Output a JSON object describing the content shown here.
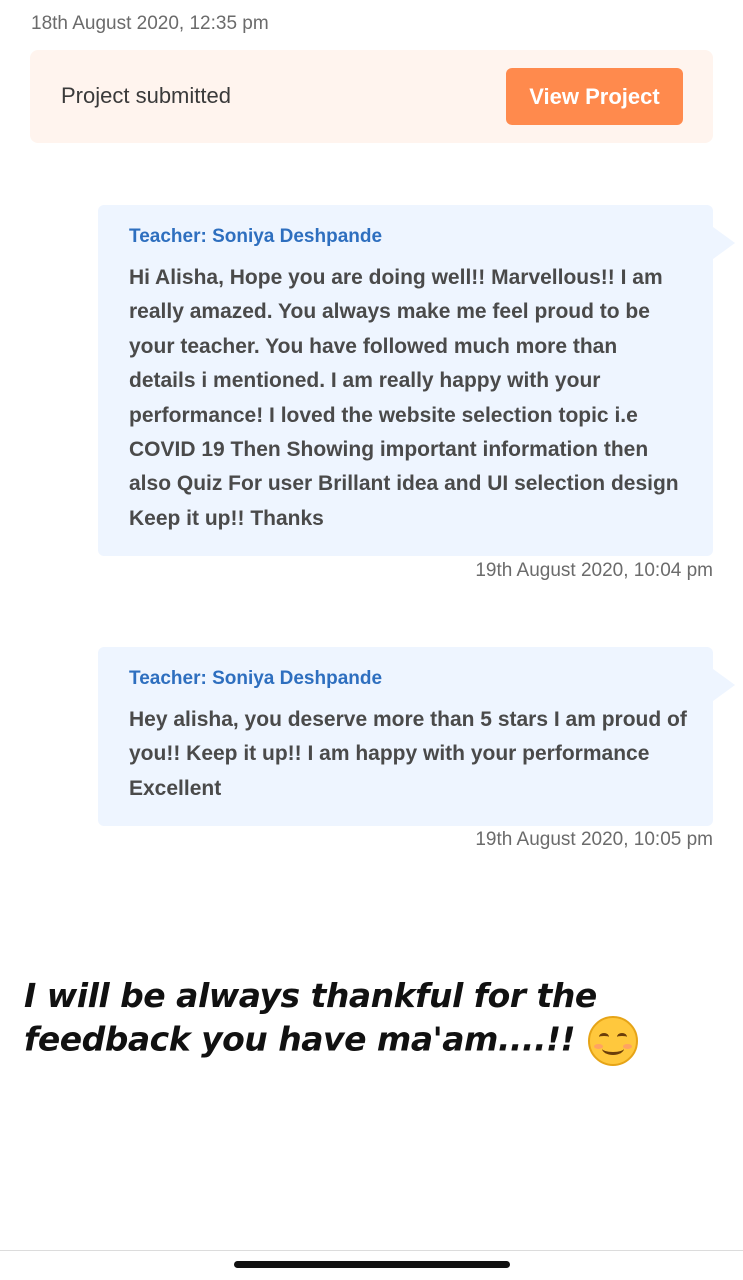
{
  "header": {
    "timestamp": "18th August 2020, 12:35 pm"
  },
  "submission": {
    "label": "Project submitted",
    "button_label": "View Project"
  },
  "messages": [
    {
      "sender": "Teacher: Soniya Deshpande",
      "text": "Hi Alisha, Hope you are doing well!! Marvellous!! I am really amazed. You always make me feel proud to be your teacher. You have followed much more than details i mentioned. I am really happy with your performance! I loved the website selection topic i.e COVID 19 Then Showing important information then also Quiz For user Brillant idea and UI selection design Keep it up!! Thanks",
      "timestamp": "19th August 2020, 10:04 pm"
    },
    {
      "sender": "Teacher: Soniya Deshpande",
      "text": "Hey alisha, you deserve more than 5 stars I am proud of you!! Keep it up!! I am happy with your performance Excellent",
      "timestamp": "19th August 2020, 10:05 pm"
    }
  ],
  "caption": {
    "text": "I will be always thankful for the feedback you have ma'am....!!",
    "emoji_icon": "smiling-face-emoji"
  },
  "colors": {
    "accent": "#ff8a4d",
    "sender": "#2e6fbf",
    "bubble": "#eef5ff",
    "card": "#fff4ee"
  }
}
